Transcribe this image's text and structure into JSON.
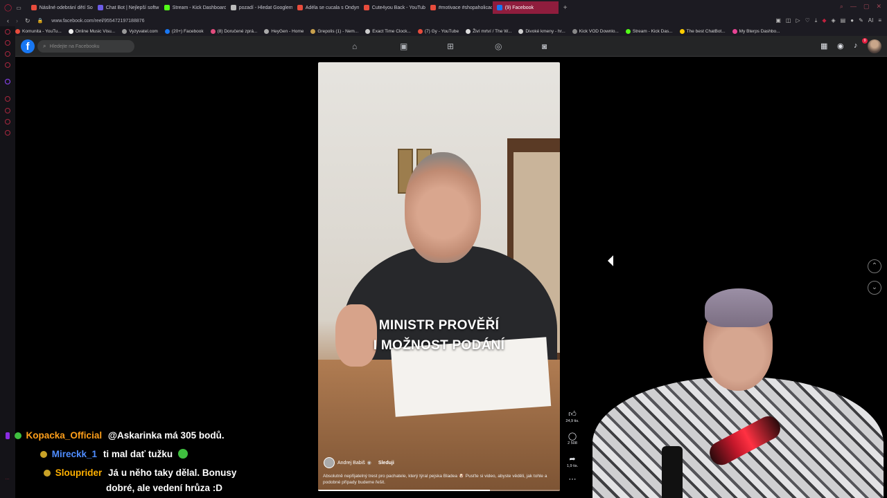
{
  "browser": {
    "tabs": [
      {
        "label": "Násilné odebrání dětí Sou",
        "color": "#e74c3c"
      },
      {
        "label": "Chat Bot | Nejlepší softw",
        "color": "#6c5ce7"
      },
      {
        "label": "Stream - Kick Dashboard",
        "color": "#53fc18"
      },
      {
        "label": "pozadí - Hledat Googlem",
        "color": "#bbbbbb"
      },
      {
        "label": "Adéla se cucala s Ondym",
        "color": "#e74c3c"
      },
      {
        "label": "Cute4you Back - YouTube",
        "color": "#e74c3c"
      },
      {
        "label": "#motivace #shopaholicac",
        "color": "#e74c3c"
      },
      {
        "label": "(9) Facebook",
        "color": "#1877f2",
        "active": true
      }
    ],
    "url": "www.facebook.com/reel/955472197188876",
    "bookmarks": [
      {
        "label": "Komunita - YouTu...",
        "color": "#e74c3c"
      },
      {
        "label": "Online Music Visu...",
        "color": "#eeeeee"
      },
      {
        "label": "Vyzyvatel.com",
        "color": "#999999"
      },
      {
        "label": "(20+) Facebook",
        "color": "#1877f2"
      },
      {
        "label": "(8) Doručené zprá...",
        "color": "#e24c7c"
      },
      {
        "label": "HeyGen - Home",
        "color": "#aaaaaa"
      },
      {
        "label": "Grepolis (1) - Nem...",
        "color": "#c8a04c"
      },
      {
        "label": "Exact Time Clock...",
        "color": "#cccccc"
      },
      {
        "label": "(7) Gy - YouTube",
        "color": "#e74c3c"
      },
      {
        "label": "Živí mrtví / The W...",
        "color": "#dddddd"
      },
      {
        "label": "Divoké kmeny - hr...",
        "color": "#cfcfcf"
      },
      {
        "label": "Kick VOD Downlo...",
        "color": "#888888"
      },
      {
        "label": "Stream - Kick Das...",
        "color": "#53fc18"
      },
      {
        "label": "The best ChatBot...",
        "color": "#ffcc00"
      },
      {
        "label": "My Bterps Dashbo...",
        "color": "#e84393"
      }
    ]
  },
  "facebook": {
    "search_placeholder": "Hledejte na Facebooku",
    "notifications_count": "9"
  },
  "reel": {
    "subtitle_line1": "MINISTR PROVĚŘÍ",
    "subtitle_line2": "I MOŽNOST PODÁNÍ",
    "author": "Andrej Babiš",
    "follow_label": "Sleduji",
    "caption": "Absolutně nepřijatelný trest pro pachatele, který týral pejska Bladea 🐶 Pusťte si video, abyste věděli, jak tohle a podobné případy budeme řešit.",
    "likes": "24,9 tis.",
    "comments": "2 508",
    "shares": "1,9 tis.",
    "progress": 0.71
  },
  "chat": [
    {
      "user": "Kopacka_Official",
      "user_color": "#ff9f1a",
      "message": "@Askarinka má 305 bodů."
    },
    {
      "user": "Mireckk_1",
      "user_color": "#4f8dff",
      "message": "ti mal dať tužku"
    },
    {
      "user": "Slouprider",
      "user_color": "#ffb000",
      "message": "Já u něho taky dělal. Bonusy",
      "message_line2": "dobré, ale vedení hrůza :D"
    }
  ]
}
